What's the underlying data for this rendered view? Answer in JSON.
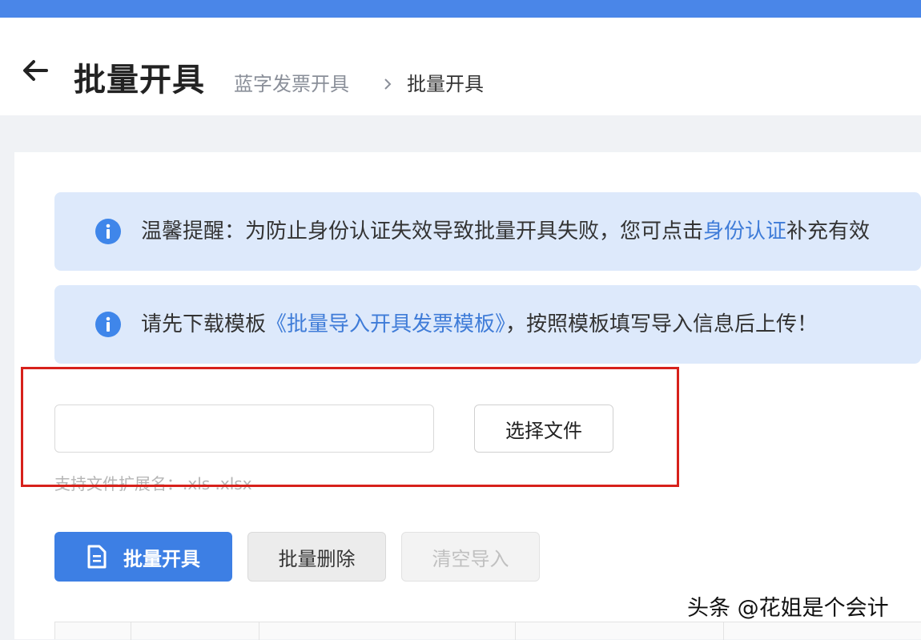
{
  "header": {
    "page_title": "批量开具",
    "breadcrumb": {
      "parent": "蓝字发票开具",
      "separator": "›",
      "current": "批量开具"
    }
  },
  "notices": [
    {
      "prefix": "温馨提醒：为防止身份认证失效导致批量开具失败，您可点击",
      "link": "身份认证",
      "suffix": "补充有效"
    },
    {
      "prefix": "请先下载模板",
      "link": "《批量导入开具发票模板》",
      "suffix": "，按照模板填写导入信息后上传！"
    }
  ],
  "upload": {
    "file_value": "",
    "choose_label": "选择文件",
    "hint": "支持文件扩展名：.xls .xlsx"
  },
  "actions": {
    "issue_label": "批量开具",
    "delete_label": "批量删除",
    "clear_label": "清空导入"
  },
  "watermark": "头条 @花姐是个会计",
  "colors": {
    "accent": "#3d7fe4",
    "top_bar": "#4a86e8",
    "notice_bg": "#dde9fb",
    "link": "#3f7cd8",
    "highlight_border": "#d7211b"
  },
  "icons": [
    "back-arrow-icon",
    "chevron-right-icon",
    "info-icon",
    "document-icon"
  ]
}
